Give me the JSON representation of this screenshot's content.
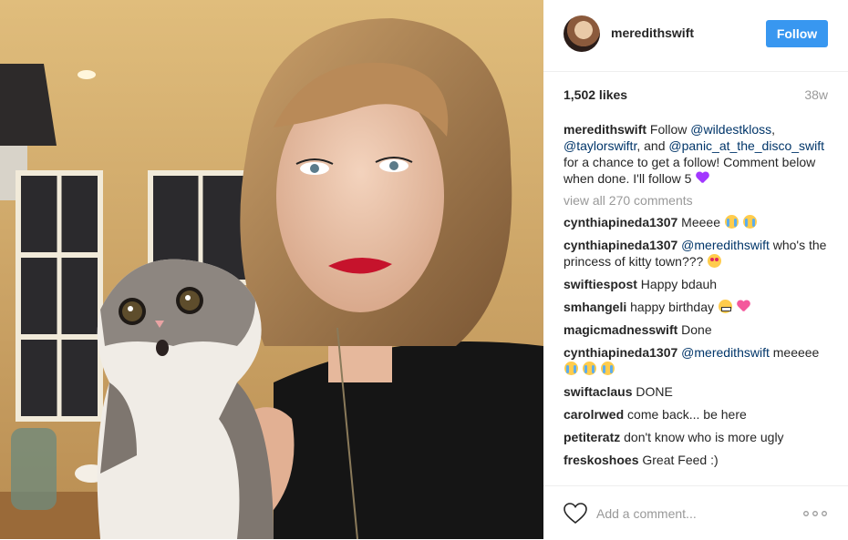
{
  "post": {
    "username": "meredithswift",
    "follow_label": "Follow",
    "likes": "1,502 likes",
    "age": "38w",
    "caption": {
      "username": "meredithswift",
      "text_1": "Follow ",
      "mention_1": "@wildestkloss",
      "text_2": ",",
      "mention_2": "@taylorswiftr",
      "text_3": ", and",
      "mention_3": "@panic_at_the_disco_swift",
      "text_4": " for a chance to get a follow! Comment below when done. I'll follow 5",
      "emoji": "purple-heart"
    },
    "view_all": "view all 270 comments",
    "comments": [
      {
        "user": "cynthiapineda1307",
        "text": "Meeee",
        "emoji": [
          "cry",
          "cry"
        ]
      },
      {
        "user": "cynthiapineda1307",
        "mention": "@meredithswift",
        "text": " who's the princess of kitty town???",
        "emoji": [
          "heart-eyes"
        ]
      },
      {
        "user": "swiftiespost",
        "text": "Happy bdauh"
      },
      {
        "user": "smhangeli",
        "text": "happy birthday",
        "emoji": [
          "grimace",
          "pink-heart"
        ]
      },
      {
        "user": "magicmadnesswift",
        "text": "Done"
      },
      {
        "user": "cynthiapineda1307",
        "mention": "@meredithswift",
        "text": " meeeee",
        "emoji": [
          "cry",
          "cry",
          "cry"
        ]
      },
      {
        "user": "swiftaclaus",
        "text": "DONE"
      },
      {
        "user": "carolrwed",
        "text": "come back... be here"
      },
      {
        "user": "petiteratz",
        "text": "don't know who is more ugly"
      },
      {
        "user": "freskoshoes",
        "text": "Great Feed :)"
      }
    ],
    "add_comment_placeholder": "Add a comment...",
    "icons": {
      "like": "heart-outline-icon",
      "more": "more-options-icon"
    }
  },
  "colors": {
    "accent": "#3897f0",
    "mention": "#003569",
    "muted": "#999999",
    "text": "#262626"
  }
}
